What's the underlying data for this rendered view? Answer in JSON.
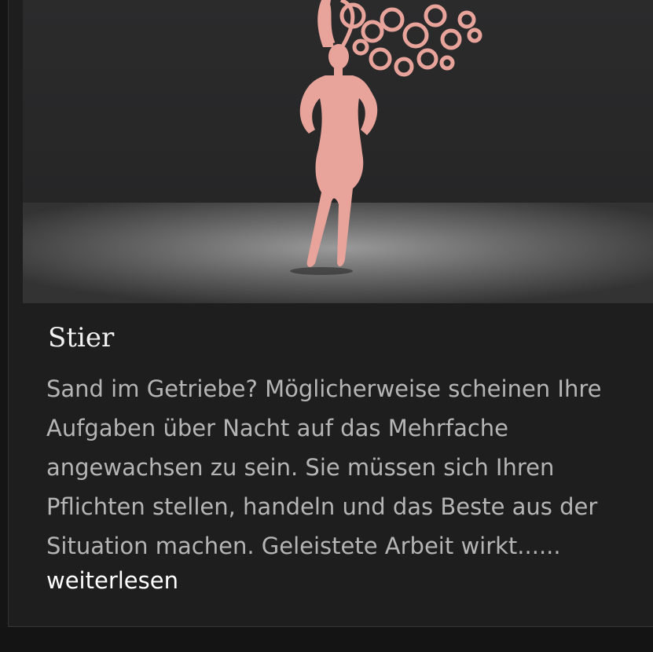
{
  "card": {
    "title": "Stier",
    "description": "Sand im Getriebe? Möglicherweise scheinen Ihre Aufgaben über Nacht auf das Mehrfache angewachsen zu sein. Sie müssen sich Ihren Pflichten stellen, handeln und das Beste aus der Situation machen. Geleistete Arbeit wirkt......",
    "read_more": "weiterlesen",
    "image": {
      "icon": "woman-silhouette-with-curly-hair-illustration",
      "figure_color": "#e8a39b",
      "background_color": "#2a2a2b",
      "floor_glow_color": "#8a8a8a"
    }
  },
  "colors": {
    "title": "#f2f2f2",
    "text": "#b5b5b5",
    "link": "#ffffff",
    "panel": "#1e1e1f"
  }
}
